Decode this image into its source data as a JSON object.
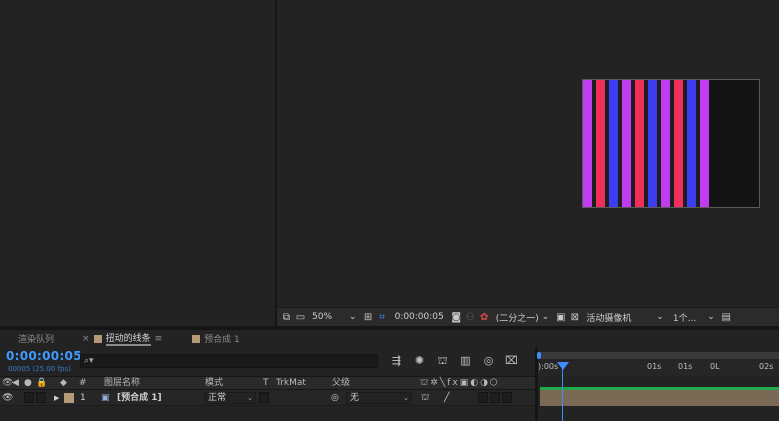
{
  "viewer": {
    "zoom": "50%",
    "timecode": "0:00:00:05",
    "resolution": "(二分之一)",
    "camera": "活动摄像机",
    "views": "1个...",
    "stripes": [
      {
        "color": "#c03cf0",
        "width": 9
      },
      {
        "color": "#1e1e1e",
        "width": 4
      },
      {
        "color": "#f0305a",
        "width": 9
      },
      {
        "color": "#1e1e1e",
        "width": 4
      },
      {
        "color": "#3c3cf0",
        "width": 9
      },
      {
        "color": "#1e1e1e",
        "width": 4
      },
      {
        "color": "#c03cf0",
        "width": 9
      },
      {
        "color": "#1e1e1e",
        "width": 4
      },
      {
        "color": "#f0305a",
        "width": 9
      },
      {
        "color": "#1e1e1e",
        "width": 4
      },
      {
        "color": "#3c3cf0",
        "width": 9
      },
      {
        "color": "#1e1e1e",
        "width": 4
      },
      {
        "color": "#c03cf0",
        "width": 9
      },
      {
        "color": "#1e1e1e",
        "width": 4
      },
      {
        "color": "#f0305a",
        "width": 9
      },
      {
        "color": "#1e1e1e",
        "width": 4
      },
      {
        "color": "#3c3cf0",
        "width": 9
      },
      {
        "color": "#1e1e1e",
        "width": 4
      },
      {
        "color": "#c03cf0",
        "width": 9
      }
    ]
  },
  "tabs": {
    "render_queue": "渲染队列",
    "active_comp": "扭动的线条",
    "precomp": "预合成 1",
    "active_color": "#b49a78",
    "precomp_color": "#b49a78"
  },
  "timeline": {
    "timecode": "0:00:00:05",
    "fps": "00005 (25.00 fps)",
    "search_placeholder": "",
    "search_icon": "search-icon",
    "columns": {
      "hash": "#",
      "layer_name": "图层名称",
      "mode": "模式",
      "t": "T",
      "trkmat": "TrkMat",
      "parent": "父级"
    },
    "ruler": {
      "start": "):00s",
      "ticks": [
        "01s",
        "01s",
        "0L",
        "02s"
      ]
    },
    "layers": [
      {
        "index": "1",
        "name": "[预合成 1]",
        "mode": "正常",
        "parent": "无",
        "label_color": "#b49a78"
      }
    ]
  }
}
